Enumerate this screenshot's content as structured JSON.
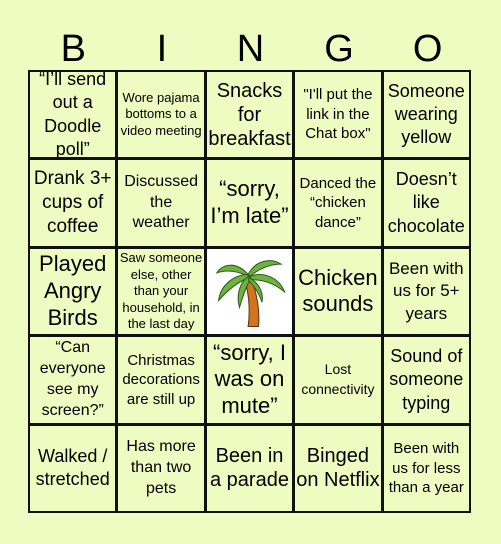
{
  "header": {
    "letters": [
      "B",
      "I",
      "N",
      "G",
      "O"
    ]
  },
  "card": {
    "cells": [
      "“I’ll send out a Doodle poll”",
      "Wore pajama bottoms to a video meeting",
      "Snacks for breakfast",
      "\"I'll put the link in the Chat box\"",
      "Someone wearing yellow",
      "Drank 3+ cups of coffee",
      "Discussed the weather",
      "“sorry, I’m late”",
      "Danced the “chicken dance”",
      "Doesn’t like chocolate",
      "Played Angry Birds",
      "Saw someone else, other than your household, in the last day",
      "",
      "Chicken sounds",
      "Been with us for 5+ years",
      "“Can everyone see my screen?”",
      "Christmas decorations are still up",
      "“sorry, I was on mute”",
      "Lost connectivity",
      "Sound of someone typing",
      "Walked / stretched",
      "Has more than two pets",
      "Been in a parade",
      "Binged on Netflix",
      "Been with us for less than a year"
    ],
    "free_space": {
      "icon": "palm-tree-icon"
    }
  },
  "colors": {
    "background": "#eefcc2",
    "grid_line": "#111111",
    "free_bg": "#ffffff"
  }
}
